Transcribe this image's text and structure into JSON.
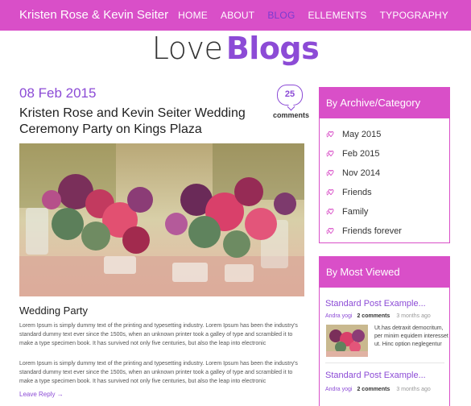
{
  "header": {
    "brand": "Kristen Rose & Kevin Seiter",
    "nav": [
      {
        "label": "HOME",
        "active": false
      },
      {
        "label": "ABOUT",
        "active": false
      },
      {
        "label": "BLOG",
        "active": true
      },
      {
        "label": "ELLEMENTS",
        "active": false
      },
      {
        "label": "TYPOGRAPHY",
        "active": false
      }
    ]
  },
  "page_heading": {
    "light": "Love",
    "bold": "Blogs"
  },
  "post": {
    "date": "08 Feb 2015",
    "comment_count": "25",
    "comments_label": "comments",
    "title": "Kristen Rose and Kevin Seiter Wedding Ceremony Party on Kings Plaza",
    "subtitle": "Wedding Party",
    "paragraph1": "Lorem Ipsum is simply dummy text of the printing and typesetting industry. Lorem Ipsum has been the industry's standard dummy text ever since the 1500s, when an unknown printer took a galley of type and scrambled it to make a type specimen book. It has survived not only five centuries, but also the leap into electronic",
    "paragraph2": "Lorem Ipsum is simply dummy text of the printing and typesetting industry. Lorem Ipsum has been the industry's standard dummy text ever since the 1500s, when an unknown printer took a galley of type and scrambled it to make a type specimen book. It has survived not only five centuries, but also the leap into electronic",
    "leave_reply": "Leave Reply →"
  },
  "sidebar": {
    "archive": {
      "head_light": "By",
      "head_bold": "Archive/Category",
      "items": [
        "May 2015",
        "Feb 2015",
        "Nov 2014",
        "Friends",
        "Family",
        "Friends forever"
      ],
      "icon": "hearts-icon"
    },
    "most_viewed": {
      "head_light": "By",
      "head_bold": "Most Viewed",
      "items": [
        {
          "title": "Standard Post Example...",
          "author": "Andra yogi",
          "comments": "2 comments",
          "time": "3 months ago",
          "excerpt": "Ut.has detraxit democritum, per minim equidem interesset ut. Hinc option neglegentur"
        },
        {
          "title": "Standard Post Example...",
          "author": "Andra yogi",
          "comments": "2 comments",
          "time": "3 months ago"
        }
      ]
    }
  },
  "colors": {
    "accent": "#d94fc8",
    "purple": "#8c4bd6"
  }
}
